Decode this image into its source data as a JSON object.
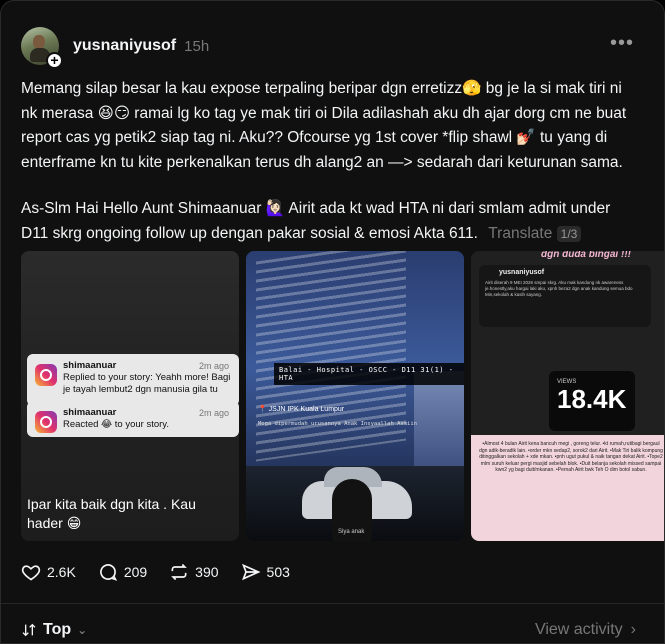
{
  "post": {
    "username": "yusnaniyusof",
    "time": "15h",
    "more_icon": "more-horizontal-icon",
    "paragraph1": "Memang silap besar la kau expose terpaling beripar dgn erretizz🫣 bg je la si mak tiri ni nk merasa 😆😏 ramai lg ko tag ye mak tiri oi Dila adilashah aku dh ajar dorg cm ne buat report cas yg petik2 siap tag ni. Aku?? Ofcourse yg 1st cover *flip shawl 💅🏻 tu yang di enterframe kn tu kite perkenalkan terus dh alang2 an —> sedarah dari keturunan sama.",
    "paragraph2": "As-Slm Hai Hello Aunt Shimaanuar 🙋🏻‍♀️ Airit ada kt wad HTA ni dari smlam admit under D11 skrg ongoing follow up dengan pakar sosial & emosi Akta 611.",
    "translate": "Translate",
    "pager": "1/3"
  },
  "media": {
    "first": {
      "notif1": {
        "name": "shimaanuar",
        "ago": "2m ago",
        "text": "Replied to your story: Yeahh more! Bagi je tayah lembut2 dgn manusia gila tu"
      },
      "notif2": {
        "name": "shimaanuar",
        "ago": "2m ago",
        "text": "Reacted 😂 to your story."
      },
      "caption": "Ipar kita baik dgn kita . Kau hader 😁"
    },
    "second": {
      "tag": "Balai - Hospital - OSCC - D11 31(1) - HTA",
      "location": "📍 JSJN IPK Kuala Lumpur",
      "sub": "Moga dipermudah urusannya Anak Insyaallah Aamiin",
      "kid_text": "Siya anak"
    },
    "third": {
      "title": "dgn duda bingai !!!",
      "inner_user": "yusnaniyusof",
      "inner_text": "Airit diserah 9 MEI 2026 smpai skrg. Aku mak kandung nk awareness je.honestly,aku hargai laki aku, xpnh beza2 dgn anak kandung semua bdo Min,sekolah & kasih sayang.",
      "views_label": "VIEWS",
      "views": "18.4K",
      "bottom_text": "•Almost 4 bulan Airit kena bancuh megi , goreng telur. •kt rumah,rutibagi bergaul dgn adik-beradik lain. •order mkn sedap2, sorok2 dari Airit. •Mak Tiri balik kompung ditinggalkan sekolah + xde mkan. •pnh ugut pukul & naik tangan dekat Airit. •Tope2 mlm suruh keluar pergi masjid sebelah blok. •Duit belanja sekolah missed sampai kwn2 yg bagi duit/mkanan. •Pernah Airit bwk Teh O dim botol sabun."
    }
  },
  "actions": {
    "likes": "2.6K",
    "comments": "209",
    "reposts": "390",
    "shares": "503"
  },
  "footer": {
    "sort": "Top",
    "view_activity": "View activity"
  }
}
